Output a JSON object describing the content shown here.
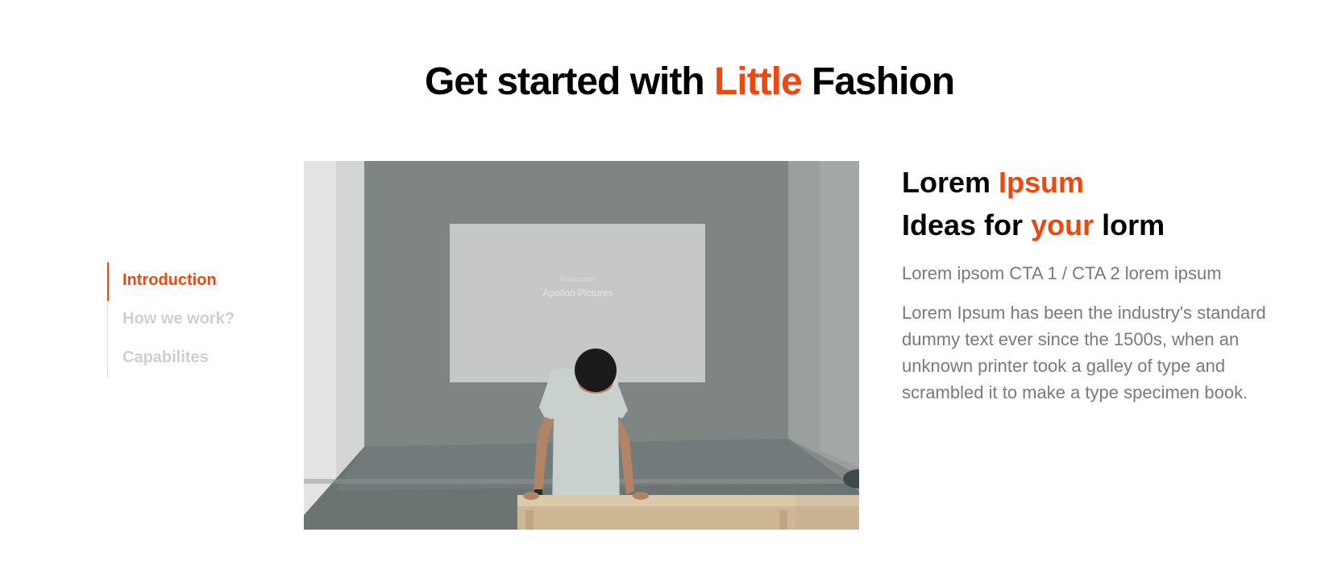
{
  "header": {
    "title_part1": "Get started with ",
    "title_accent": "Little",
    "title_part2": " Fashion"
  },
  "tabs": {
    "items": [
      {
        "label": "Introduction",
        "active": true
      },
      {
        "label": "How we work?",
        "active": false
      },
      {
        "label": "Capabilites",
        "active": false
      }
    ]
  },
  "photo": {
    "screen_text_small": "Production",
    "screen_text_large": "Apollon Pictures"
  },
  "content": {
    "heading_line1_part1": "Lorem ",
    "heading_line1_accent": "Ipsum",
    "heading_line2_part1": "Ideas for ",
    "heading_line2_accent": "your",
    "heading_line2_part2": " lorm",
    "cta_line": "Lorem ipsom CTA 1 / CTA 2 lorem ipsum",
    "body": "Lorem Ipsum has been the industry's standard dummy text ever since the 1500s, when an unknown printer took a galley of type and scrambled it to make a type specimen book."
  },
  "colors": {
    "accent": "#f0470f",
    "text_dark": "#000000",
    "text_muted": "#7a7a7a",
    "tab_inactive": "#cfcfcf"
  }
}
